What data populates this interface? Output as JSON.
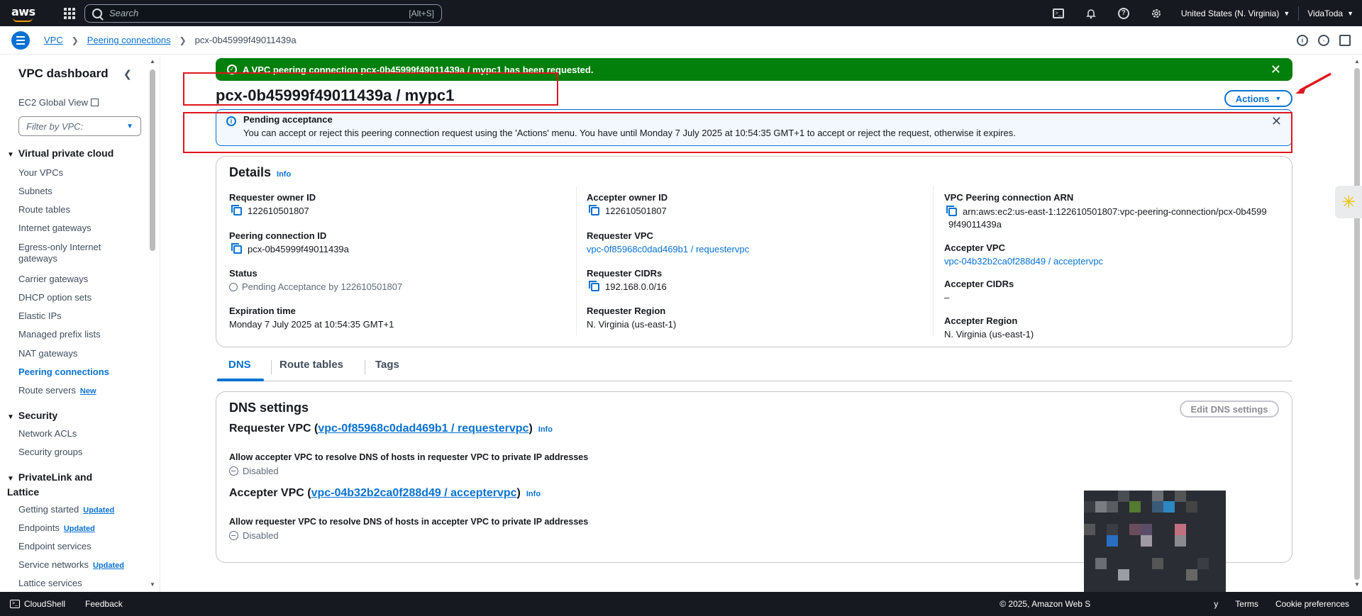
{
  "topnav": {
    "logo": "aws",
    "search_placeholder": "Search",
    "search_shortcut": "[Alt+S]",
    "region": "United States (N. Virginia)",
    "account": "VidaToda"
  },
  "breadcrumb": {
    "items": [
      "VPC",
      "Peering connections"
    ],
    "current": "pcx-0b45999f49011439a"
  },
  "sidebar": {
    "title": "VPC dashboard",
    "ec2_global_view": "EC2 Global View",
    "filter_placeholder": "Filter by VPC:",
    "sections": [
      {
        "title": "Virtual private cloud",
        "items": [
          "Your VPCs",
          "Subnets",
          "Route tables",
          "Internet gateways",
          "Egress-only Internet gateways",
          "Carrier gateways",
          "DHCP option sets",
          "Elastic IPs",
          "Managed prefix lists",
          "NAT gateways",
          "Peering connections",
          "Route servers"
        ]
      },
      {
        "title": "Security",
        "items": [
          "Network ACLs",
          "Security groups"
        ]
      },
      {
        "title": "PrivateLink and Lattice",
        "items": [
          "Getting started",
          "Endpoints",
          "Endpoint services",
          "Service networks",
          "Lattice services"
        ]
      }
    ],
    "badge_new": "New",
    "badge_updated": "Updated"
  },
  "flash_success": "A VPC peering connection pcx-0b45999f49011439a / mypc1 has been requested.",
  "page_title": "pcx-0b45999f49011439a / mypc1",
  "actions_label": "Actions",
  "flash_info": {
    "title": "Pending acceptance",
    "text": "You can accept or reject this peering connection request using the 'Actions' menu. You have until Monday 7 July 2025 at 10:54:35 GMT+1 to accept or reject the request, otherwise it expires."
  },
  "details": {
    "heading": "Details",
    "info": "Info",
    "requester_owner_id_label": "Requester owner ID",
    "requester_owner_id": "122610501807",
    "peering_connection_id_label": "Peering connection ID",
    "peering_connection_id": "pcx-0b45999f49011439a",
    "status_label": "Status",
    "status": "Pending Acceptance by 122610501807",
    "expiration_label": "Expiration time",
    "expiration": "Monday 7 July 2025 at 10:54:35 GMT+1",
    "accepter_owner_id_label": "Accepter owner ID",
    "accepter_owner_id": "122610501807",
    "requester_vpc_label": "Requester VPC",
    "requester_vpc": "vpc-0f85968c0dad469b1 / requestervpc",
    "requester_cidrs_label": "Requester CIDRs",
    "requester_cidrs": "192.168.0.0/16",
    "requester_region_label": "Requester Region",
    "requester_region": "N. Virginia (us-east-1)",
    "arn_label": "VPC Peering connection ARN",
    "arn_line1": "arn:aws:ec2:us-east-1:122610501807:vpc-peering-connection/pcx-0b4599",
    "arn_line2": "9f49011439a",
    "accepter_vpc_label": "Accepter VPC",
    "accepter_vpc": "vpc-04b32b2ca0f288d49 / acceptervpc",
    "accepter_cidrs_label": "Accepter CIDRs",
    "accepter_cidrs": "–",
    "accepter_region_label": "Accepter Region",
    "accepter_region": "N. Virginia (us-east-1)"
  },
  "tabs": [
    "DNS",
    "Route tables",
    "Tags"
  ],
  "dns": {
    "heading": "DNS settings",
    "edit_label": "Edit DNS settings",
    "requester_prefix": "Requester VPC (",
    "requester_link": "vpc-0f85968c0dad469b1 / requestervpc",
    "suffix": ")",
    "info": "Info",
    "requester_allow_label": "Allow accepter VPC to resolve DNS of hosts in requester VPC to private IP addresses",
    "requester_allow_value": "Disabled",
    "accepter_prefix": "Accepter VPC (",
    "accepter_link": "vpc-04b32b2ca0f288d49 / acceptervpc",
    "accepter_allow_label": "Allow requester VPC to resolve DNS of hosts in accepter VPC to private IP addresses",
    "accepter_allow_value": "Disabled"
  },
  "footer": {
    "cloudshell": "CloudShell",
    "feedback": "Feedback",
    "copyright": "© 2025, Amazon Web S",
    "privacy_fragment": "y",
    "terms": "Terms",
    "cookie": "Cookie preferences"
  },
  "colors": {
    "accent": "#0972d3",
    "success": "#037f0c",
    "nav_bg": "#16191f",
    "annotation": "#e0161e"
  }
}
